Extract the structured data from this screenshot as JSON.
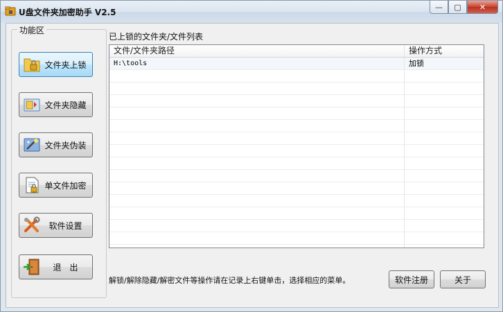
{
  "window": {
    "title": "U盘文件夹加密助手 V2.5",
    "minimize_glyph": "—",
    "maximize_glyph": "▢",
    "close_glyph": "✕"
  },
  "sidebar": {
    "group_title": "功能区",
    "buttons": [
      {
        "label": "文件夹上锁",
        "icon": "folder-lock-icon"
      },
      {
        "label": "文件夹隐藏",
        "icon": "folder-hide-icon"
      },
      {
        "label": "文件夹伪装",
        "icon": "folder-disguise-icon"
      },
      {
        "label": "单文件加密",
        "icon": "file-encrypt-icon"
      },
      {
        "label": "软件设置",
        "icon": "settings-tools-icon"
      },
      {
        "label": "退　出",
        "icon": "exit-door-icon"
      }
    ]
  },
  "main": {
    "list_title": "已上锁的文件夹/文件列表",
    "columns": [
      "文件/文件夹路径",
      "操作方式"
    ],
    "rows": [
      {
        "path": "H:\\tools",
        "action": "加锁"
      }
    ],
    "hint": "解锁/解除隐藏/解密文件等操作请在记录上右键单击，选择相应的菜单。",
    "register_label": "软件注册",
    "about_label": "关于"
  },
  "colors": {
    "title_bar": "#dbe5f0",
    "close_button": "#c8422e",
    "active_button": "#bee6fd"
  }
}
